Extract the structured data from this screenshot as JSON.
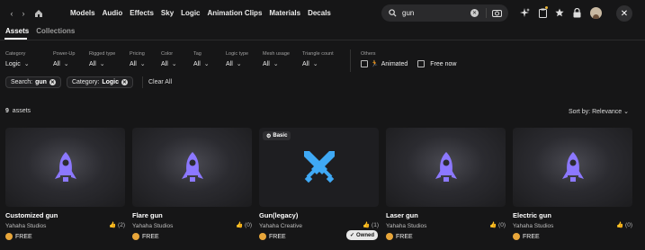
{
  "topbar": {
    "categories": [
      "Models",
      "Audio",
      "Effects",
      "Sky",
      "Logic",
      "Animation Clips",
      "Materials",
      "Decals"
    ]
  },
  "search": {
    "value": "gun"
  },
  "tabs": [
    "Assets",
    "Collections"
  ],
  "filters": [
    {
      "label": "Category",
      "value": "Logic"
    },
    {
      "label": "Power-Up",
      "value": "All"
    },
    {
      "label": "Rigged type",
      "value": "All"
    },
    {
      "label": "Pricing",
      "value": "All"
    },
    {
      "label": "Color",
      "value": "All"
    },
    {
      "label": "Tag",
      "value": "All"
    },
    {
      "label": "Logic type",
      "value": "All"
    },
    {
      "label": "Mesh usage",
      "value": "All"
    },
    {
      "label": "Triangle count",
      "value": "All"
    }
  ],
  "others": {
    "label": "Others",
    "animated": "Animated",
    "free_now": "Free now"
  },
  "chips": [
    {
      "prefix": "Search: ",
      "value": "gun"
    },
    {
      "prefix": "Category: ",
      "value": "Logic"
    }
  ],
  "clear_all": "Clear All",
  "results": {
    "count": "9",
    "count_label": "assets",
    "sort": "Sort by: Relevance"
  },
  "cards": [
    {
      "title": "Customized gun",
      "author": "Yahaha Studios",
      "likes": "(2)",
      "price": "FREE",
      "badge": "",
      "owned": ""
    },
    {
      "title": "Flare gun",
      "author": "Yahaha Studios",
      "likes": "(0)",
      "price": "FREE",
      "badge": "",
      "owned": ""
    },
    {
      "title": "Gun(legacy)",
      "author": "Yahaha Creative",
      "likes": "(1)",
      "price": "FREE",
      "badge": "Basic",
      "owned": "Owned"
    },
    {
      "title": "Laser gun",
      "author": "Yahaha Studios",
      "likes": "(0)",
      "price": "FREE",
      "badge": "",
      "owned": ""
    },
    {
      "title": "Electric gun",
      "author": "Yahaha Studios",
      "likes": "(0)",
      "price": "FREE",
      "badge": "",
      "owned": ""
    }
  ]
}
